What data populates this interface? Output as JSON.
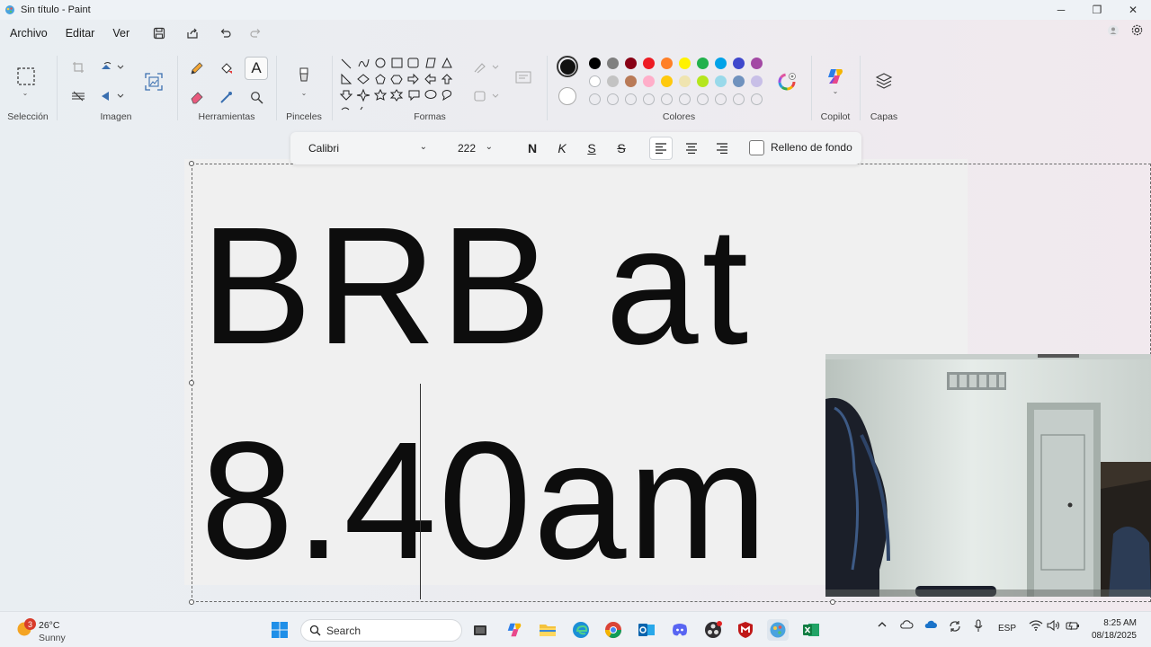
{
  "window": {
    "title": "Sin título - Paint",
    "controls": {
      "minimize": "─",
      "maximize": "❐",
      "close": "✕"
    }
  },
  "menu": {
    "items": [
      "Archivo",
      "Editar",
      "Ver"
    ]
  },
  "ribbon": {
    "groups": {
      "selection": "Selección",
      "image": "Imagen",
      "tools": "Herramientas",
      "brushes": "Pinceles",
      "shapes": "Formas",
      "colors": "Colores",
      "copilot": "Copilot",
      "layers": "Capas"
    },
    "active_color": "#111111",
    "palette_row1": [
      "#000000",
      "#7f7f7f",
      "#880015",
      "#ed1c24",
      "#ff7f27",
      "#fff200",
      "#22b14c",
      "#00a2e8",
      "#3f48cc",
      "#a349a4"
    ],
    "palette_row2": [
      "#ffffff",
      "#c3c3c3",
      "#b97a57",
      "#ffaec9",
      "#ffc90e",
      "#efe4b0",
      "#b5e61d",
      "#99d9ea",
      "#7092be",
      "#c8bfe7"
    ]
  },
  "text_toolbar": {
    "font": "Calibri",
    "size": "222",
    "bold": "N",
    "italic": "K",
    "underline": "S",
    "strike": "S",
    "fill_label": "Relleno de fondo",
    "fill_checked": false
  },
  "canvas": {
    "line1": "BRB at",
    "line2": "8.40am"
  },
  "taskbar": {
    "weather": {
      "temp": "26°C",
      "condition": "Sunny",
      "badge": "3"
    },
    "search_placeholder": "Search",
    "language": "ESP",
    "time": "8:25 AM",
    "date": "08/18/2025"
  }
}
